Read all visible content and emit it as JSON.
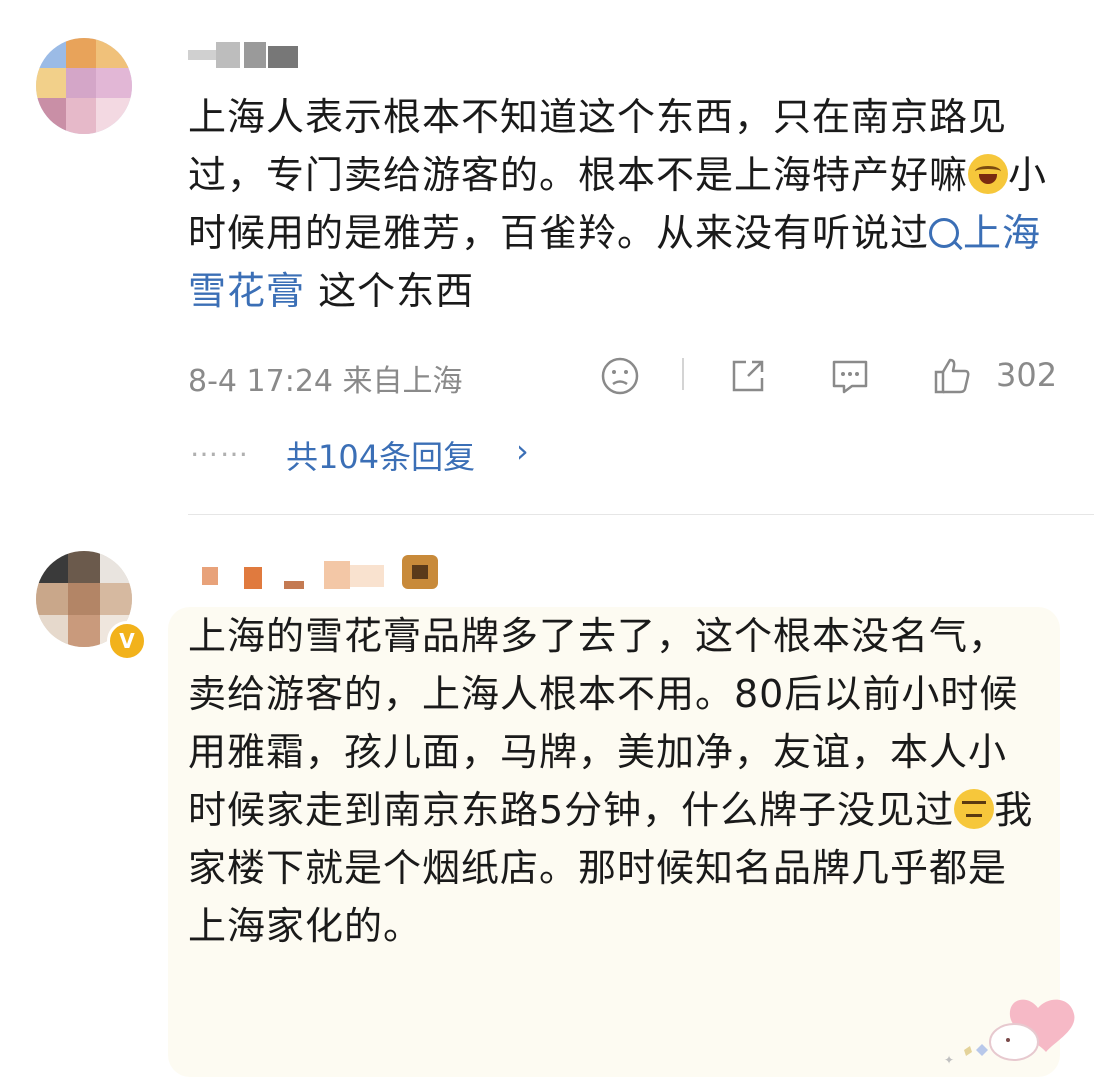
{
  "comments": [
    {
      "text_before": "上海人表示根本不知道这个东西，只在南京路见过，专门卖给游客的。根本不是上海特产好嘛",
      "text_middle": "小时候用的是雅芳，百雀羚。从来没有听说过",
      "topic": "上海雪花膏",
      "text_after": " 这个东西",
      "emoji": "laugh-cry-emoji",
      "time": "8-4 17:24 来自上海",
      "likes": "302",
      "replies_label": "共104条回复",
      "replies_dots": "……",
      "icons": [
        "dislike-face-icon",
        "share-icon",
        "comment-icon",
        "like-icon"
      ]
    },
    {
      "text_before": "上海的雪花膏品牌多了去了，这个根本没名气，卖给游客的，上海人根本不用。80后以前小时候用雅霜，孩儿面，马牌，美加净，友谊，本人小时候家走到南京东路5分钟，什么牌子没见过",
      "text_after": "我家楼下就是个烟纸店。那时候知名品牌几乎都是上海家化的。",
      "emoji": "thinking-emoji",
      "verified_badge": "V"
    }
  ],
  "colors": {
    "link": "#3b6fb6",
    "meta": "#8a8a8a",
    "bubble": "#fdfbf2",
    "badge": "#f2b21b"
  }
}
